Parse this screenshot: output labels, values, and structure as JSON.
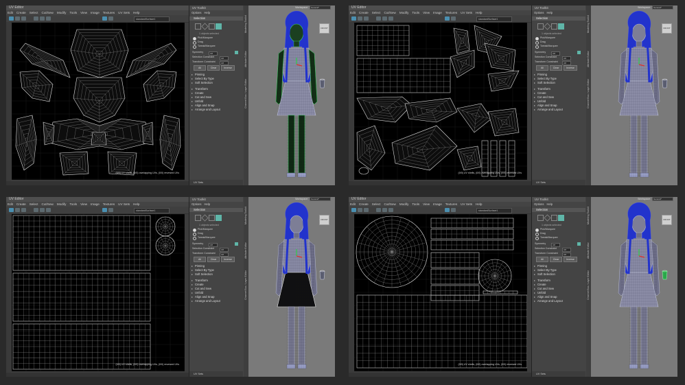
{
  "uv_editor": {
    "title": "UV Editor",
    "menu": [
      "Edit",
      "Create",
      "Select",
      "Cut/Sew",
      "Modify",
      "Tools",
      "View",
      "Image",
      "Textures",
      "UV Sets",
      "Help"
    ],
    "texture_field": "standardSurface1",
    "uv_set_label": "UV Sets"
  },
  "toolkit": {
    "title": "UV Toolkit",
    "menu": [
      "Options",
      "Help"
    ],
    "selection_header": "Selection",
    "objects_selected": "1 objects selected",
    "pick_marquee": "Pick/Marquee",
    "drag": "Drag",
    "tweak_marquee": "Tweak/Marquee",
    "symmetry_label": "Symmetry",
    "symmetry_value": "Off",
    "selection_constraint_label": "Selection Constraint",
    "selection_constraint_value": "Off",
    "transform_constraint_label": "Transform Constraint",
    "transform_constraint_value": "Off",
    "all_btn": "All",
    "clear_btn": "Clear",
    "inverse_btn": "Inverse",
    "sections": [
      "Pinning",
      "Select By Type",
      "Soft Selection",
      "Transform",
      "Create",
      "Cut and Sew",
      "Unfold",
      "Align and Snap",
      "Arrange and Layout"
    ]
  },
  "side_tabs": [
    "Channel Box / Layer Editor",
    "Attribute Editor",
    "Modeling Toolkit"
  ],
  "workspace": {
    "label": "Workspace:",
    "value": "General*"
  },
  "viewcube_label": "FRONT",
  "quadrants": [
    {
      "hud": "(0/0) UV shells, (0/0) overlapping UVs, (0/0) reversed UVs",
      "highlight": "#3ed866",
      "subject": "body_and_face"
    },
    {
      "hud": "(0/0) UV shells, (0/0) overlapping UVs, (0/0) reversed UVs",
      "highlight": "none",
      "subject": "hair"
    },
    {
      "hud": "(0/0) UV shells, (0/0) overlapping UVs, (0/0) reversed UVs",
      "highlight": "#e8e8e8",
      "subject": "skirt"
    },
    {
      "hud": "(0/0) UV shells, (0/0) overlapping UVs, (0/0) reversed UVs",
      "highlight": "#3ed866",
      "subject": "cup"
    }
  ],
  "colors": {
    "hair": "#2233cc",
    "skin_wire": "#b8bcd4",
    "mesh_green": "#3ed866",
    "accent": "#5fb5a8"
  }
}
